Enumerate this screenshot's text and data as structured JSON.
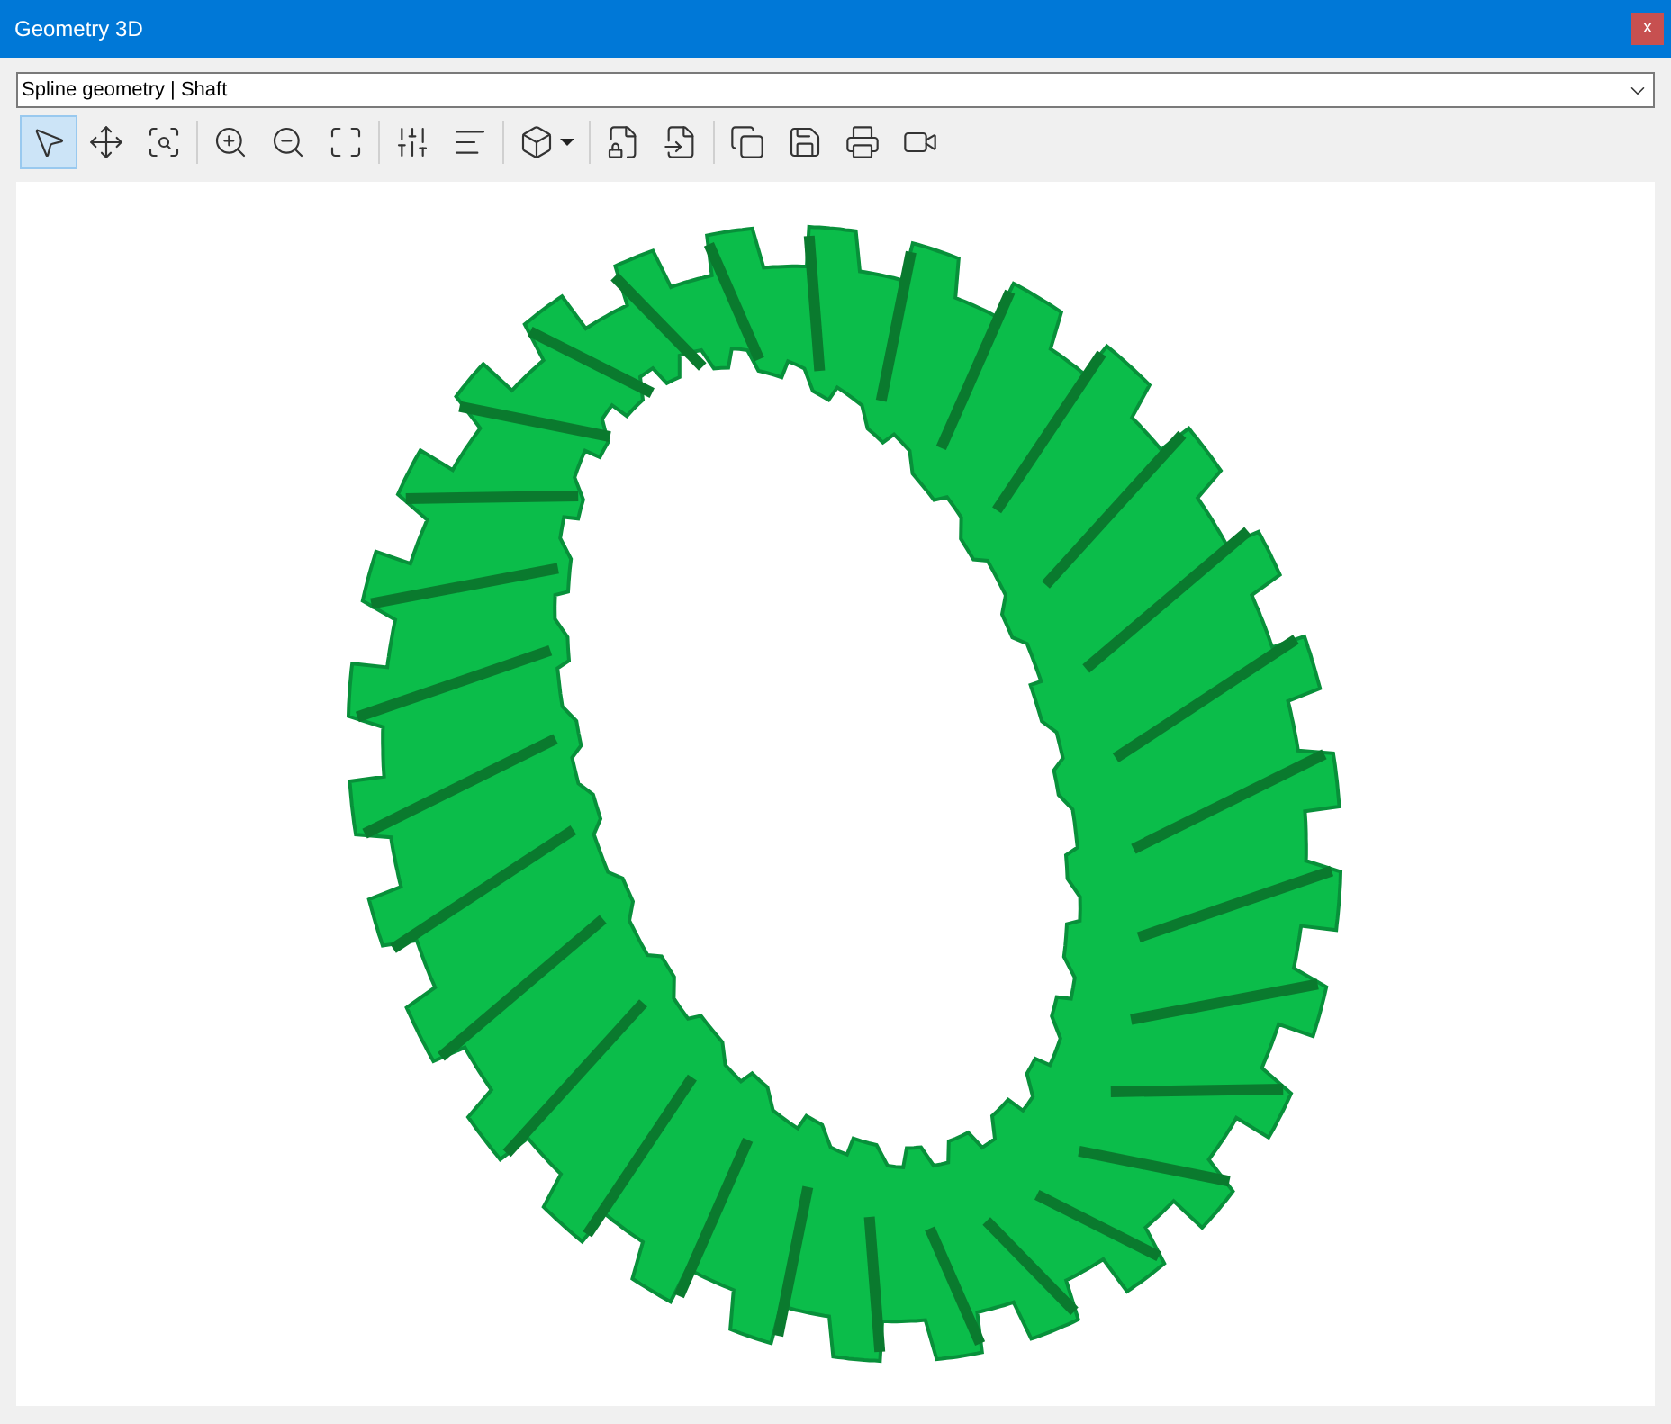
{
  "window": {
    "title": "Geometry 3D",
    "close_label": "x"
  },
  "selector": {
    "value": "Spline geometry | Shaft"
  },
  "toolbar": [
    [
      {
        "kind": "select",
        "selected": true
      },
      {
        "kind": "pan",
        "selected": false
      },
      {
        "kind": "zoom-window",
        "selected": false
      }
    ],
    [
      {
        "kind": "zoom-in",
        "selected": false
      },
      {
        "kind": "zoom-out",
        "selected": false
      },
      {
        "kind": "zoom-all",
        "selected": false
      }
    ],
    [
      {
        "kind": "sliders",
        "selected": false
      },
      {
        "kind": "text",
        "selected": false
      }
    ],
    [
      {
        "kind": "view-box",
        "selected": false
      }
    ],
    [
      {
        "kind": "file-lock",
        "selected": false
      },
      {
        "kind": "file-import",
        "selected": false
      }
    ],
    [
      {
        "kind": "copy",
        "selected": false
      },
      {
        "kind": "save",
        "selected": false
      },
      {
        "kind": "print",
        "selected": false
      },
      {
        "kind": "video",
        "selected": false
      }
    ]
  ]
}
